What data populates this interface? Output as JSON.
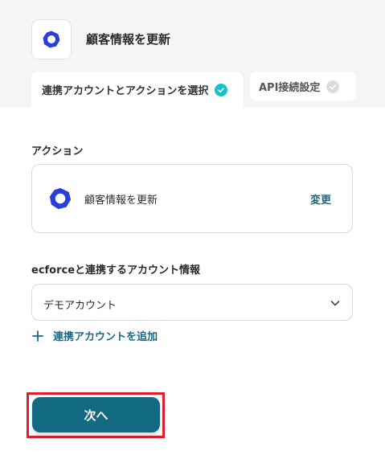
{
  "header": {
    "title": "顧客情報を更新",
    "app_icon": "ecforce-ring-icon"
  },
  "tabs": [
    {
      "label": "連携アカウントとアクションを選択",
      "state": "active"
    },
    {
      "label": "API接続設定",
      "state": "inactive"
    }
  ],
  "action_section": {
    "label": "アクション",
    "action_name": "顧客情報を更新",
    "change_label": "変更"
  },
  "account_section": {
    "label": "ecforceと連携するアカウント情報",
    "selected": "デモアカウント",
    "add_account_label": "連携アカウントを追加"
  },
  "footer": {
    "next_label": "次へ"
  },
  "colors": {
    "accent": "#126a82",
    "link": "#1a6a84",
    "check_active": "#19c2c9",
    "icon_blue": "#2a3fd6",
    "highlight": "#e01e2b"
  }
}
